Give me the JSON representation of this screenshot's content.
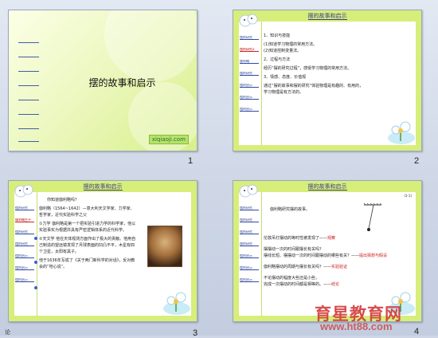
{
  "slides": [
    {
      "number": "1",
      "title": "摆的故事和启示",
      "logo": "xiqiaoji.com"
    },
    {
      "number": "2",
      "header": "摆的故事和启示",
      "menu": [
        "摆的研究",
        "摆的研究2",
        "伽利略",
        "摆的研究",
        "摆的启示",
        "摆的启示",
        "摆的启示"
      ],
      "lines": [
        "1、知识与技能",
        "(1)知道学习物理的常用方法。",
        "(2)知道控制变量法。",
        "2、过程与方法",
        "经历“摆的研究过程”，感受学习物理的常用方法。",
        "3、情感、态度、价值观",
        "通过“摆的故事和摆的研究”体验物理是有趣的、有用的，",
        "学习物理是有方法的。"
      ]
    },
    {
      "number": "3",
      "header": "摆的故事和启示",
      "menu": [
        "摆的研究",
        "伽利略生平",
        "摆的研究",
        "摆的研究",
        "摆的启示",
        "摆的启示",
        "摆的启示"
      ],
      "intro": "你知道伽利略吗？",
      "para1": "伽利略（1564~1642）—意大利天文学家、力学家、哲学家，近代实验科学之父",
      "para2": "①力学  伽利略是第一个把实验引进力学的科学家，他以实验事实为根据并具有严密逻辑体系的近代科学。",
      "para3": "②天文学  他在天体观测方面作出了极大的贡献。他用自己制造的望远镜发现了月球表面的凹凸不平，木星有四个卫星，太阳有黑子。",
      "para4": "他于1636年写成了《关于两门新科学的对话》，反对教会的“地心说”。"
    },
    {
      "number": "4",
      "header": "摆的故事和启示",
      "menu": [
        "摆的研究",
        "摆的研究",
        "摆的研究",
        "摆的研究",
        "摆的启示",
        "摆的启示",
        "摆的启示"
      ],
      "corner": "(3-1)",
      "intro": "伽利略研究摆的故事。",
      "q1": "伦敦吊灯摆动的等时性被发现了——",
      "a1": "观察",
      "q2": "摆摆动一次的时间跟摆长有关吗？",
      "q3": "摆线长短、摆摆动一次的时间跟摆动的哪些有关？——",
      "a3": "提出猜想与假设",
      "q4": "伽利略摆动的周期与摆长有关吗？——",
      "a4": "实验验证",
      "q5": "不论摆动的幅度大些还是小些，",
      "q6": "完成一次摆动的时间都是相等的。——",
      "a6": "结论"
    }
  ],
  "watermark": {
    "line1": "育星教育网",
    "line2": "www.ht88.com"
  },
  "footer": {
    "left": "论"
  }
}
